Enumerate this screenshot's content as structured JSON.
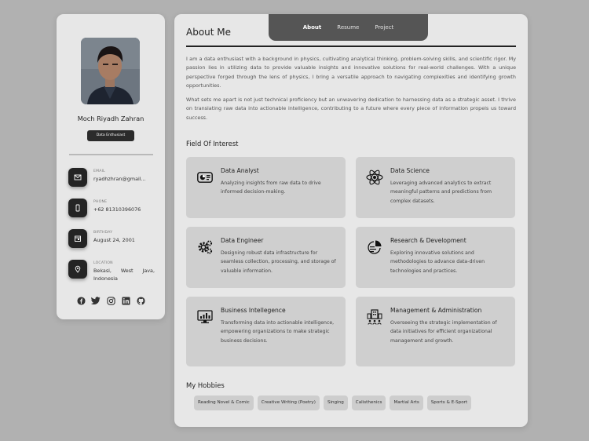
{
  "profile": {
    "name": "Moch Riyadh Zahran",
    "badge": "Data Enthusiast",
    "contacts": [
      {
        "label": "EMAIL",
        "value": "ryadhzhran@gmail...",
        "icon": "mail-icon"
      },
      {
        "label": "PHONE",
        "value": "+62 81310396076",
        "icon": "phone-icon"
      },
      {
        "label": "BIRTHDAY",
        "value": "August 24, 2001",
        "icon": "calendar-icon"
      },
      {
        "label": "LOCATION",
        "value": "Bekasi, West Java, Indonesia",
        "icon": "location-icon"
      }
    ],
    "socials": [
      "facebook-icon",
      "twitter-icon",
      "instagram-icon",
      "linkedin-icon",
      "github-icon"
    ]
  },
  "nav": {
    "tabs": [
      "About",
      "Resume",
      "Project"
    ],
    "active": "About"
  },
  "about": {
    "title": "About Me",
    "paragraphs": [
      "I am a data enthusiast with a background in physics, cultivating analytical thinking, problem-solving skills, and scientific rigor. My passion lies in utilizing data to provide valuable insights and innovative solutions for real-world challenges. With a unique perspective forged through the lens of physics, I bring a versatile approach to navigating complexities and identifying growth opportunities.",
      "What sets me apart is not just technical proficiency but an unwavering dedication to harnessing data as a strategic asset. I thrive on translating raw data into actionable intelligence, contributing to a future where every piece of information propels us toward success."
    ]
  },
  "interests": {
    "title": "Field Of Interest",
    "items": [
      {
        "title": "Data Analyst",
        "desc": "Analyzing insights from raw data to drive informed decision-making.",
        "icon": "dashboard-icon"
      },
      {
        "title": "Data Science",
        "desc": "Leveraging advanced analytics to extract meaningful patterns and predictions from complex datasets.",
        "icon": "atom-icon"
      },
      {
        "title": "Data Engineer",
        "desc": "Designing robust data infrastructure for seamless collection, processing, and storage of valuable information.",
        "icon": "gears-icon"
      },
      {
        "title": "Research & Development",
        "desc": "Exploring innovative solutions and methodologies to advance data-driven technologies and practices.",
        "icon": "research-chart-icon"
      },
      {
        "title": "Business Intellegence",
        "desc": "Transforming data into actionable intelligence, empowering organizations to make strategic business decisions.",
        "icon": "monitor-chart-icon"
      },
      {
        "title": "Management & Administration",
        "desc": "Overseeing the strategic implementation of data initiatives for efficient organizational management and growth.",
        "icon": "organization-icon"
      }
    ]
  },
  "hobbies": {
    "title": "My Hobbies",
    "items": [
      "Reading Novel & Comic",
      "Creative Writing (Poetry)",
      "Singing",
      "Calisthenics",
      "Martial Arts",
      "Sports & E-Sport"
    ]
  }
}
